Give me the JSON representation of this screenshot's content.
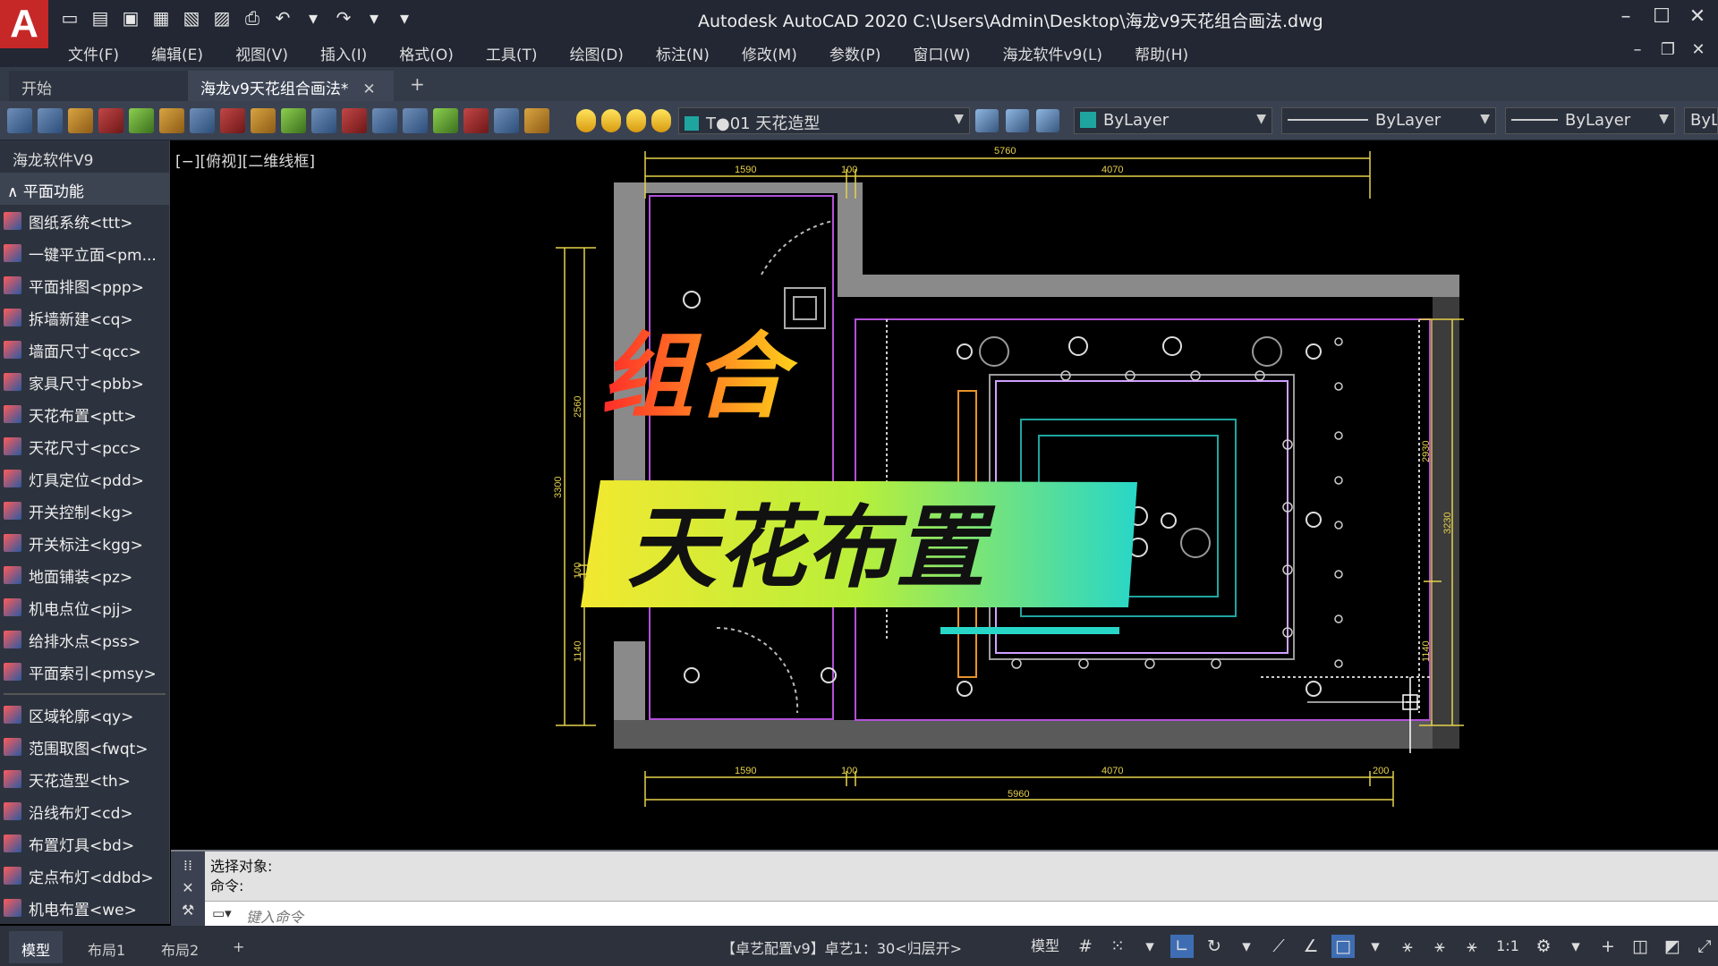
{
  "app": {
    "logo_letter": "A",
    "title": "Autodesk AutoCAD 2020   C:\\Users\\Admin\\Desktop\\海龙v9天花组合画法.dwg"
  },
  "menu": [
    "文件(F)",
    "编辑(E)",
    "视图(V)",
    "插入(I)",
    "格式(O)",
    "工具(T)",
    "绘图(D)",
    "标注(N)",
    "修改(M)",
    "参数(P)",
    "窗口(W)",
    "海龙软件v9(L)",
    "帮助(H)"
  ],
  "tabs": {
    "start": "开始",
    "active": "海龙v9天花组合画法*",
    "close": "✕",
    "add": "+"
  },
  "toolbar": {
    "layer": "T●01 天花造型",
    "color": "ByLayer",
    "linetype": "ByLayer",
    "lineweight": "ByLayer",
    "plotstyle": "ByL"
  },
  "sidebar": {
    "title": "海龙软件V9",
    "section": "平面功能",
    "items": [
      "图纸系统<ttt>",
      "一键平立面<pm...",
      "平面排图<ppp>",
      "拆墙新建<cq>",
      "墙面尺寸<qcc>",
      "家具尺寸<pbb>",
      "天花布置<ptt>",
      "天花尺寸<pcc>",
      "灯具定位<pdd>",
      "开关控制<kg>",
      "开关标注<kgg>",
      "地面铺装<pz>",
      "机电点位<pjj>",
      "给排水点<pss>",
      "平面索引<pmsy>"
    ],
    "items2": [
      "区域轮廓<qy>",
      "范围取图<fwqt>",
      "天花造型<th>",
      "沿线布灯<cd>",
      "布置灯具<bd>",
      "定点布灯<ddbd>",
      "机电布置<we>"
    ]
  },
  "viewport": {
    "label": "[−][俯视][二维线框]"
  },
  "drawing": {
    "dims_top": [
      "5760",
      "1590",
      "100",
      "4070"
    ],
    "dims_bottom": [
      "1590",
      "100",
      "4070",
      "200",
      "5960"
    ],
    "dims_left": [
      "2560",
      "3300",
      "100",
      "1140"
    ],
    "dims_right": [
      "2930",
      "3230",
      "1140"
    ]
  },
  "overlay": {
    "line1": "组合",
    "line2": "天花布置"
  },
  "command": {
    "history": [
      "选择对象:",
      "命令:"
    ],
    "placeholder": "键入命令"
  },
  "status": {
    "tabs": [
      "模型",
      "布局1",
      "布局2"
    ],
    "add": "+",
    "text": "【卓艺配置v9】卓艺1：30<归层开>",
    "model": "模型",
    "scale": "1:1"
  },
  "colors": {
    "wall": "#8a8a8a",
    "dim": "#e6d24a",
    "ceiling": "#b050d8",
    "cyan": "#1fa5a0"
  }
}
